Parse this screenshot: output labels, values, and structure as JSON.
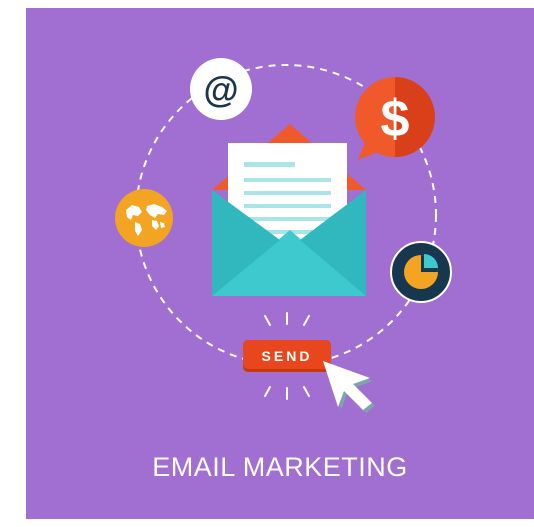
{
  "illustration": {
    "at_symbol": "@",
    "dollar_symbol": "$",
    "send_button_label": "SEND",
    "caption": "EMAIL MARKETING"
  },
  "icons": {
    "at": "at-sign-icon",
    "dollar": "dollar-speech-bubble-icon",
    "globe": "world-map-icon",
    "pie": "pie-chart-icon",
    "envelope": "open-envelope-icon",
    "cursor": "mouse-cursor-icon"
  },
  "colors": {
    "background": "#a06fd1",
    "envelope_teal": "#3ec9cf",
    "envelope_dark_teal": "#2aa6ad",
    "envelope_flap_orange": "#f05a2b",
    "send_button": "#e8461c",
    "dollar_bubble": "#f05a2b",
    "globe_yellow": "#f2a422",
    "pie_navy": "#17374f",
    "at_text": "#1b3550",
    "caption_text": "#ffffff"
  }
}
